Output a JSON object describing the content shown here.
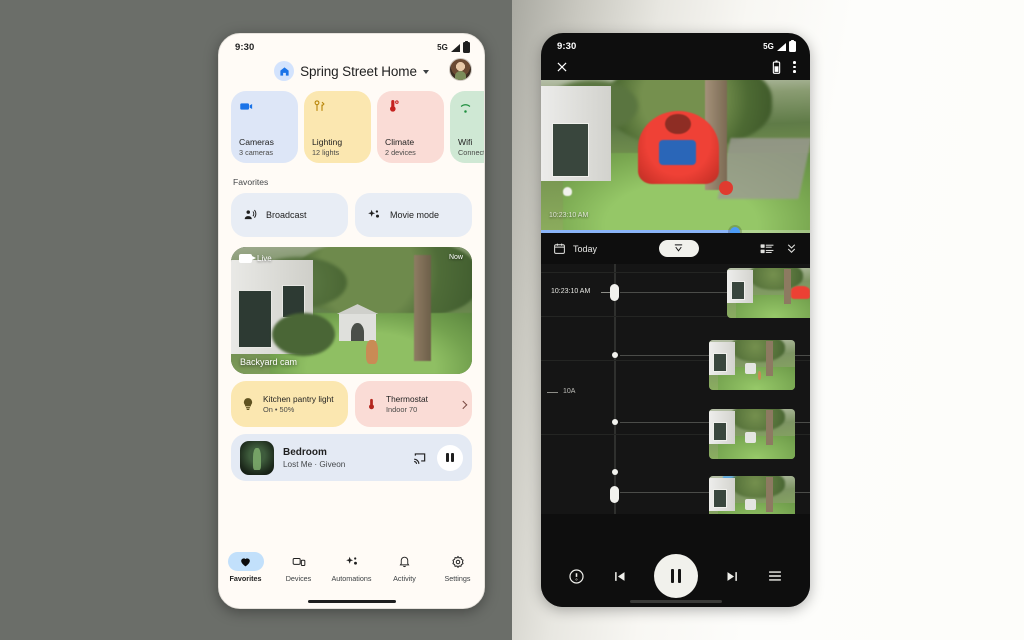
{
  "background": {
    "left_color": "#6b6e69",
    "right_color": "#fdfdfb"
  },
  "left_phone": {
    "status_bar": {
      "time": "9:30",
      "network": "5G",
      "signal_icon": "signal-bars-icon",
      "battery_icon": "battery-icon"
    },
    "header": {
      "home_icon": "home-icon",
      "title": "Spring Street Home",
      "chevron_icon": "chevron-down-icon",
      "avatar": "user-avatar"
    },
    "categories": [
      {
        "icon": "video-camera-icon",
        "name": "Cameras",
        "sub": "3 cameras",
        "color": "#dde6f7"
      },
      {
        "icon": "lighting-icon",
        "name": "Lighting",
        "sub": "12 lights",
        "color": "#fbe7b0"
      },
      {
        "icon": "thermometer-icon",
        "name": "Climate",
        "sub": "2 devices",
        "color": "#fadcd6"
      },
      {
        "icon": "wifi-icon",
        "name": "Wifi",
        "sub": "Connected",
        "color": "#cfe8d4"
      }
    ],
    "favorites_label": "Favorites",
    "favorites": [
      {
        "icon": "broadcast-icon",
        "label": "Broadcast"
      },
      {
        "icon": "sparkle-icon",
        "label": "Movie mode"
      }
    ],
    "camera_card": {
      "live_badge": "Live",
      "live_icon": "video-camera-icon",
      "timestamp": "Now",
      "name": "Backyard cam"
    },
    "tiles": [
      {
        "icon": "bulb-icon",
        "title": "Kitchen pantry light",
        "sub": "On • 50%",
        "color": "#fbe7b0"
      },
      {
        "icon": "thermometer-icon",
        "title": "Thermostat",
        "sub": "Indoor 70",
        "color": "#fadcd6",
        "chevron": "chevron-right-icon"
      }
    ],
    "media": {
      "album_art": "album-art",
      "title": "Bedroom",
      "subtitle": "Lost Me · Giveon",
      "cast_icon": "cast-icon",
      "pause_icon": "pause-icon"
    },
    "nav": [
      {
        "icon": "heart-filled-icon",
        "label": "Favorites",
        "selected": true
      },
      {
        "icon": "devices-icon",
        "label": "Devices",
        "selected": false
      },
      {
        "icon": "sparkle-icon",
        "label": "Automations",
        "selected": false
      },
      {
        "icon": "bell-icon",
        "label": "Activity",
        "selected": false
      },
      {
        "icon": "gear-icon",
        "label": "Settings",
        "selected": false
      }
    ]
  },
  "right_phone": {
    "status_bar": {
      "time": "9:30",
      "network": "5G",
      "signal_icon": "signal-bars-icon",
      "battery_icon": "battery-icon"
    },
    "app_bar": {
      "close_icon": "close-icon",
      "battery_status_icon": "battery-icon",
      "overflow_icon": "overflow-menu-icon"
    },
    "video": {
      "timestamp_overlay": "10:23:10 AM",
      "progress_percent": 72
    },
    "toolbar": {
      "calendar_icon": "calendar-icon",
      "date_label": "Today",
      "jump_icon": "jump-to-top-icon",
      "list_icon": "list-view-icon",
      "collapse_icon": "collapse-icon"
    },
    "timeline": {
      "current_time": "10:23:10 AM",
      "hour_tick": "10A",
      "events": [
        {
          "time": "10:23:10 AM",
          "thumbnail": "event-thumbnail-1"
        },
        {
          "time": "",
          "thumbnail": "event-thumbnail-2"
        },
        {
          "time": "",
          "thumbnail": "event-thumbnail-3"
        },
        {
          "time": "",
          "thumbnail": "event-thumbnail-4"
        }
      ]
    },
    "controls": [
      {
        "icon": "info-icon",
        "name": "info-button"
      },
      {
        "icon": "skip-previous-icon",
        "name": "previous-button"
      },
      {
        "icon": "pause-icon",
        "name": "play-pause-button"
      },
      {
        "icon": "skip-next-icon",
        "name": "next-button"
      },
      {
        "icon": "menu-icon",
        "name": "menu-button"
      }
    ]
  }
}
